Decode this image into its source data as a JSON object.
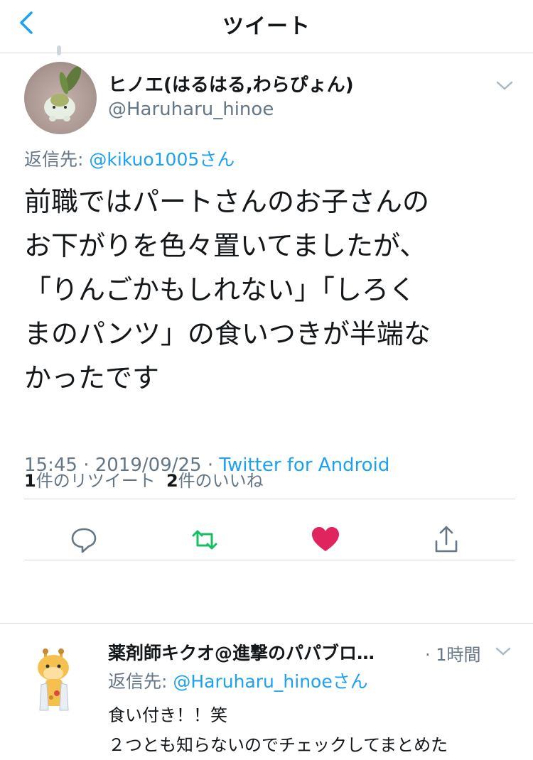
{
  "header": {
    "title": "ツイート",
    "back_icon": "chevron-left-icon",
    "accent": "#1da1f2"
  },
  "tweet": {
    "name": "ヒノエ(はるはる,わらぴょん)",
    "handle": "@Haruharu_hinoe",
    "reply_label": "返信先: ",
    "reply_to": "@kikuo1005さん",
    "text": "前職ではパートさんのお子さんの\nお下がりを色々置いてましたが、\n「りんごかもしれない」「しろく\nまのパンツ」の食いつきが半端な\nかったです",
    "time": "15:45 · 2019/09/25 · ",
    "source": "Twitter for Android",
    "retweets_count": "1",
    "retweets_label": "件のリツイート",
    "likes_count": "2",
    "likes_label": "件のいいね",
    "actions": {
      "reply_icon": "comment-icon",
      "retweet_icon": "retweet-icon",
      "like_icon": "heart-icon",
      "share_icon": "share-icon",
      "retweet_color": "#17bf63",
      "like_color": "#e0245e"
    }
  },
  "reply": {
    "name": "薬剤師キクオ@進撃のパパブロ…",
    "time": "· 1時間",
    "reply_label": "返信先: ",
    "reply_to": "@Haruharu_hinoeさん",
    "text": "食い付き！！笑\n２つとも知らないのでチェックしてまとめた"
  }
}
